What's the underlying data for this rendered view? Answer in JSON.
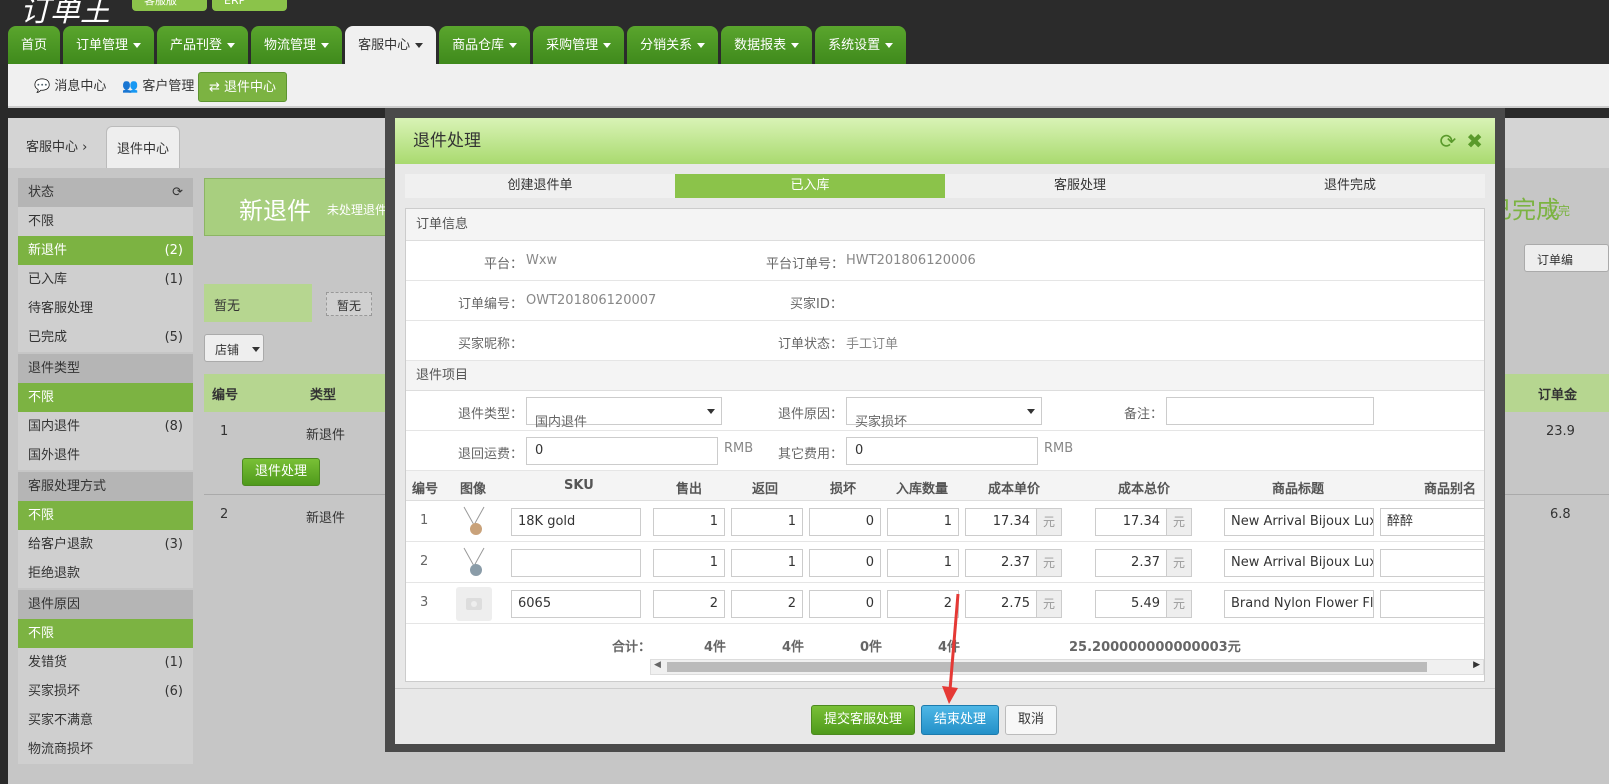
{
  "logo": "订单王",
  "versions": [
    "客服版",
    "ERP"
  ],
  "nav": {
    "tabs": [
      "首页",
      "订单管理",
      "产品刊登",
      "物流管理",
      "客服中心",
      "商品仓库",
      "采购管理",
      "分销关系",
      "数据报表",
      "系统设置"
    ],
    "active": "客服中心"
  },
  "subnav": {
    "items": [
      "消息中心",
      "客户管理",
      "退件中心"
    ],
    "active": "退件中心"
  },
  "breadcrumb": {
    "root": "客服中心",
    "current": "退件中心"
  },
  "sidebar": {
    "status_title": "状态",
    "status_items": [
      {
        "label": "不限",
        "count": ""
      },
      {
        "label": "新退件",
        "count": "(2)"
      },
      {
        "label": "已入库",
        "count": "(1)"
      },
      {
        "label": "待客服处理",
        "count": ""
      },
      {
        "label": "已完成",
        "count": "(5)"
      }
    ],
    "type_title": "退件类型",
    "type_items": [
      {
        "label": "不限",
        "count": ""
      },
      {
        "label": "国内退件",
        "count": "(8)"
      },
      {
        "label": "国外退件",
        "count": ""
      }
    ],
    "method_title": "客服处理方式",
    "method_items": [
      {
        "label": "不限",
        "count": ""
      },
      {
        "label": "给客户退款",
        "count": "(3)"
      },
      {
        "label": "拒绝退款",
        "count": ""
      }
    ],
    "reason_title": "退件原因",
    "reason_items": [
      {
        "label": "不限",
        "count": ""
      },
      {
        "label": "发错货",
        "count": "(1)"
      },
      {
        "label": "买家损坏",
        "count": "(6)"
      },
      {
        "label": "买家不满意",
        "count": ""
      },
      {
        "label": "物流商损坏",
        "count": ""
      }
    ]
  },
  "background": {
    "banner_title": "新退件",
    "banner_sub": "未处理退件",
    "banner_right": "已完成",
    "banner_right_sub": "已完",
    "filter_label": "暂无",
    "filter_tag": "暂无",
    "store_btn": "店铺",
    "col_no": "编号",
    "col_type": "类型",
    "col_amount": "订单金",
    "rows": [
      {
        "no": "1",
        "type": "新退件",
        "amount": "23.9"
      },
      {
        "no": "2",
        "type": "新退件",
        "amount": "6.8"
      }
    ],
    "process_btn": "退件处理",
    "order_btn": "订单编"
  },
  "modal": {
    "title": "退件处理",
    "steps": [
      "创建退件单",
      "已入库",
      "客服处理",
      "退件完成"
    ],
    "active_step": "已入库",
    "order_section": "订单信息",
    "platform_label": "平台：",
    "platform": "Wxw",
    "platform_order_label": "平台订单号：",
    "platform_order": "HWT201806120006",
    "order_no_label": "订单编号：",
    "order_no": "OWT201806120007",
    "buyer_id_label": "买家ID：",
    "buyer_id": "",
    "buyer_nick_label": "买家昵称：",
    "buyer_nick": "",
    "order_status_label": "订单状态：",
    "order_status": "手工订单",
    "item_section": "退件项目",
    "return_type_label": "退件类型：",
    "return_type": "国内退件",
    "reason_label": "退件原因：",
    "reason": "买家损坏",
    "note_label": "备注：",
    "note": "",
    "freight_label": "退回运费：",
    "freight": "0",
    "freight_unit": "RMB",
    "other_label": "其它费用：",
    "other": "0",
    "other_unit": "RMB",
    "table": {
      "headers": [
        "编号",
        "图像",
        "SKU",
        "售出",
        "返回",
        "损坏",
        "入库数量",
        "成本单价",
        "成本总价",
        "商品标题",
        "商品别名"
      ],
      "unit": "元",
      "rows": [
        {
          "no": "1",
          "sku": "18K gold",
          "sold": "1",
          "returned": "1",
          "damaged": "0",
          "stock": "1",
          "unit_cost": "17.34",
          "total_cost": "17.34",
          "title": "New Arrival Bijoux Luxur",
          "alias": "醉醉"
        },
        {
          "no": "2",
          "sku": "",
          "sold": "1",
          "returned": "1",
          "damaged": "0",
          "stock": "1",
          "unit_cost": "2.37",
          "total_cost": "2.37",
          "title": "New Arrival Bijoux Luxur",
          "alias": ""
        },
        {
          "no": "3",
          "sku": "6065",
          "sold": "2",
          "returned": "2",
          "damaged": "0",
          "stock": "2",
          "unit_cost": "2.75",
          "total_cost": "5.49",
          "title": "Brand Nylon Flower Flor",
          "alias": ""
        }
      ],
      "total_label": "合计：",
      "total_sold": "4件",
      "total_returned": "4件",
      "total_damaged": "0件",
      "total_stock": "4件",
      "total_cost": "25.200000000000003元"
    },
    "buttons": {
      "submit": "提交客服处理",
      "finish": "结束处理",
      "cancel": "取消"
    }
  },
  "colors": {
    "accent": "#7cb342",
    "blue": "#2390c8",
    "arrow": "#e53935"
  }
}
